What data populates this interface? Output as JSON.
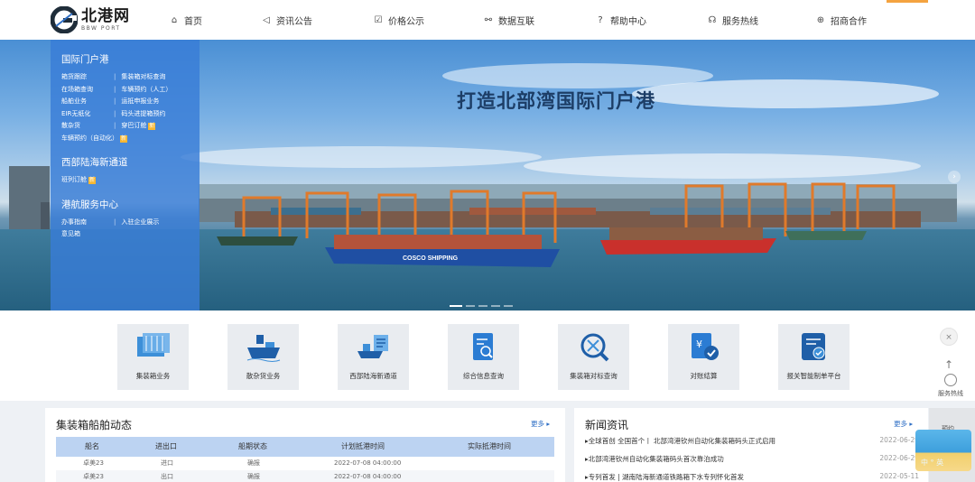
{
  "logo": {
    "cn": "北港网",
    "en": "BBW PORT"
  },
  "nav": [
    {
      "icon": "home-icon",
      "glyph": "⌂",
      "label": "首页"
    },
    {
      "icon": "speaker-icon",
      "glyph": "◁",
      "label": "资讯公告"
    },
    {
      "icon": "price-icon",
      "glyph": "☑",
      "label": "价格公示"
    },
    {
      "icon": "network-icon",
      "glyph": "⚯",
      "label": "数据互联"
    },
    {
      "icon": "help-icon",
      "glyph": "?",
      "label": "帮助中心"
    },
    {
      "icon": "headset-icon",
      "glyph": "☊",
      "label": "服务热线"
    },
    {
      "icon": "globe-icon",
      "glyph": "⊕",
      "label": "招商合作"
    }
  ],
  "hero": {
    "title": "打造北部湾国际门户港",
    "ship_label": "COSCO SHIPPING"
  },
  "side": {
    "sections": [
      {
        "title": "国际门户港",
        "links": [
          {
            "label": "箱货跟踪",
            "isNew": false
          },
          {
            "label": "集装箱对标查询",
            "isNew": false
          },
          {
            "label": "在场箱查询",
            "isNew": false
          },
          {
            "label": "车辆预约（人工）",
            "isNew": false
          },
          {
            "label": "船舶业务",
            "isNew": false
          },
          {
            "label": "运抵申报业务",
            "isNew": false
          },
          {
            "label": "EIR无纸化",
            "isNew": false
          },
          {
            "label": "码头进提箱预约",
            "isNew": false
          },
          {
            "label": "散杂货",
            "isNew": false
          },
          {
            "label": "穿巴订舱",
            "isNew": true
          },
          {
            "label": "车辆预约（自动化）",
            "isNew": true
          }
        ]
      },
      {
        "title": "西部陆海新通道",
        "links": [
          {
            "label": "班列订舱",
            "isNew": true
          }
        ]
      },
      {
        "title": "港航服务中心",
        "links": [
          {
            "label": "办事指南",
            "isNew": false
          },
          {
            "label": "入驻企业展示",
            "isNew": false
          },
          {
            "label": "意见箱",
            "isNew": false
          }
        ]
      }
    ],
    "new_badge": "新"
  },
  "services": [
    {
      "icon": "container-icon",
      "label": "集装箱业务"
    },
    {
      "icon": "cargo-ship-icon",
      "label": "散杂货业务"
    },
    {
      "icon": "sea-rail-icon",
      "label": "西部陆海新通道"
    },
    {
      "icon": "info-query-icon",
      "label": "综合信息查询"
    },
    {
      "icon": "container-search-icon",
      "label": "集装箱对标查询"
    },
    {
      "icon": "settlement-icon",
      "label": "对账结算"
    },
    {
      "icon": "customs-icon",
      "label": "报关智能制单平台"
    }
  ],
  "vessels": {
    "title": "集装箱船舶动态",
    "more": "更多",
    "columns": [
      "船名",
      "进出口",
      "船期状态",
      "计划抵港时间",
      "实际抵港时间"
    ],
    "rows": [
      [
        "卓美23",
        "进口",
        "确报",
        "2022-07-08 04:00:00",
        ""
      ],
      [
        "卓美23",
        "出口",
        "确报",
        "2022-07-08 04:00:00",
        ""
      ]
    ]
  },
  "news": {
    "title": "新闻资讯",
    "more": "更多",
    "items": [
      {
        "text": "全球首创 全国首个丨 北部湾港钦州自动化集装箱码头正式启用",
        "date": "2022-06-29"
      },
      {
        "text": "北部湾港钦州自动化集装箱码头首次靠泊成功",
        "date": "2022-06-29"
      },
      {
        "text": "专列首发 | 湖南陆海新通道铁路箱下水专列怀化首发",
        "date": "2022-05-11"
      }
    ]
  },
  "float": {
    "close": "×",
    "top": "↑",
    "service_label": "服务热线",
    "gray_label": "预约",
    "widget_label": "中 ° 英"
  }
}
